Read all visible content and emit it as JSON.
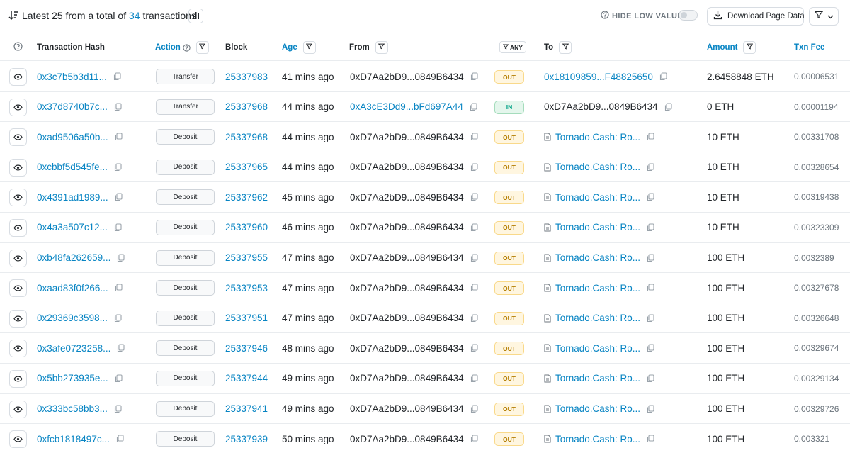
{
  "summary": {
    "prefix": "Latest 25 from a total of",
    "count": "34",
    "suffix": "transactions"
  },
  "toolbar": {
    "hide_low_value": "HIDE LOW VALUE",
    "hide_low_value_on": false,
    "download": "Download Page Data"
  },
  "columns": {
    "hash": "Transaction Hash",
    "action": "Action",
    "block": "Block",
    "age": "Age",
    "from": "From",
    "direction_filter": "ANY",
    "to": "To",
    "amount": "Amount",
    "fee": "Txn Fee"
  },
  "colors": {
    "link": "#0784c3",
    "out_badge": "#b47d00",
    "in_badge": "#00a186"
  },
  "rows": [
    {
      "hash": "0x3c7b5b3d11...",
      "action": "Transfer",
      "block": "25337983",
      "age": "41 mins ago",
      "from": "0xD7Aa2bD9...0849B6434",
      "from_link": false,
      "dir": "OUT",
      "to": "0x18109859...F48825650",
      "to_link": true,
      "to_contract": false,
      "amount": "2.6458848 ETH",
      "fee": "0.00006531"
    },
    {
      "hash": "0x37d8740b7c...",
      "action": "Transfer",
      "block": "25337968",
      "age": "44 mins ago",
      "from": "0xA3cE3Dd9...bFd697A44",
      "from_link": true,
      "dir": "IN",
      "to": "0xD7Aa2bD9...0849B6434",
      "to_link": false,
      "to_contract": false,
      "amount": "0 ETH",
      "fee": "0.00001194"
    },
    {
      "hash": "0xad9506a50b...",
      "action": "Deposit",
      "block": "25337968",
      "age": "44 mins ago",
      "from": "0xD7Aa2bD9...0849B6434",
      "from_link": false,
      "dir": "OUT",
      "to": "Tornado.Cash: Ro...",
      "to_link": true,
      "to_contract": true,
      "amount": "10 ETH",
      "fee": "0.00331708"
    },
    {
      "hash": "0xcbbf5d545fe...",
      "action": "Deposit",
      "block": "25337965",
      "age": "44 mins ago",
      "from": "0xD7Aa2bD9...0849B6434",
      "from_link": false,
      "dir": "OUT",
      "to": "Tornado.Cash: Ro...",
      "to_link": true,
      "to_contract": true,
      "amount": "10 ETH",
      "fee": "0.00328654"
    },
    {
      "hash": "0x4391ad1989...",
      "action": "Deposit",
      "block": "25337962",
      "age": "45 mins ago",
      "from": "0xD7Aa2bD9...0849B6434",
      "from_link": false,
      "dir": "OUT",
      "to": "Tornado.Cash: Ro...",
      "to_link": true,
      "to_contract": true,
      "amount": "10 ETH",
      "fee": "0.00319438"
    },
    {
      "hash": "0x4a3a507c12...",
      "action": "Deposit",
      "block": "25337960",
      "age": "46 mins ago",
      "from": "0xD7Aa2bD9...0849B6434",
      "from_link": false,
      "dir": "OUT",
      "to": "Tornado.Cash: Ro...",
      "to_link": true,
      "to_contract": true,
      "amount": "10 ETH",
      "fee": "0.00323309"
    },
    {
      "hash": "0xb48fa262659...",
      "action": "Deposit",
      "block": "25337955",
      "age": "47 mins ago",
      "from": "0xD7Aa2bD9...0849B6434",
      "from_link": false,
      "dir": "OUT",
      "to": "Tornado.Cash: Ro...",
      "to_link": true,
      "to_contract": true,
      "amount": "100 ETH",
      "fee": "0.0032389"
    },
    {
      "hash": "0xaad83f0f266...",
      "action": "Deposit",
      "block": "25337953",
      "age": "47 mins ago",
      "from": "0xD7Aa2bD9...0849B6434",
      "from_link": false,
      "dir": "OUT",
      "to": "Tornado.Cash: Ro...",
      "to_link": true,
      "to_contract": true,
      "amount": "100 ETH",
      "fee": "0.00327678"
    },
    {
      "hash": "0x29369c3598...",
      "action": "Deposit",
      "block": "25337951",
      "age": "47 mins ago",
      "from": "0xD7Aa2bD9...0849B6434",
      "from_link": false,
      "dir": "OUT",
      "to": "Tornado.Cash: Ro...",
      "to_link": true,
      "to_contract": true,
      "amount": "100 ETH",
      "fee": "0.00326648"
    },
    {
      "hash": "0x3afe0723258...",
      "action": "Deposit",
      "block": "25337946",
      "age": "48 mins ago",
      "from": "0xD7Aa2bD9...0849B6434",
      "from_link": false,
      "dir": "OUT",
      "to": "Tornado.Cash: Ro...",
      "to_link": true,
      "to_contract": true,
      "amount": "100 ETH",
      "fee": "0.00329674"
    },
    {
      "hash": "0x5bb273935e...",
      "action": "Deposit",
      "block": "25337944",
      "age": "49 mins ago",
      "from": "0xD7Aa2bD9...0849B6434",
      "from_link": false,
      "dir": "OUT",
      "to": "Tornado.Cash: Ro...",
      "to_link": true,
      "to_contract": true,
      "amount": "100 ETH",
      "fee": "0.00329134"
    },
    {
      "hash": "0x333bc58bb3...",
      "action": "Deposit",
      "block": "25337941",
      "age": "49 mins ago",
      "from": "0xD7Aa2bD9...0849B6434",
      "from_link": false,
      "dir": "OUT",
      "to": "Tornado.Cash: Ro...",
      "to_link": true,
      "to_contract": true,
      "amount": "100 ETH",
      "fee": "0.00329726"
    },
    {
      "hash": "0xfcb1818497c...",
      "action": "Deposit",
      "block": "25337939",
      "age": "50 mins ago",
      "from": "0xD7Aa2bD9...0849B6434",
      "from_link": false,
      "dir": "OUT",
      "to": "Tornado.Cash: Ro...",
      "to_link": true,
      "to_contract": true,
      "amount": "100 ETH",
      "fee": "0.003321"
    }
  ]
}
